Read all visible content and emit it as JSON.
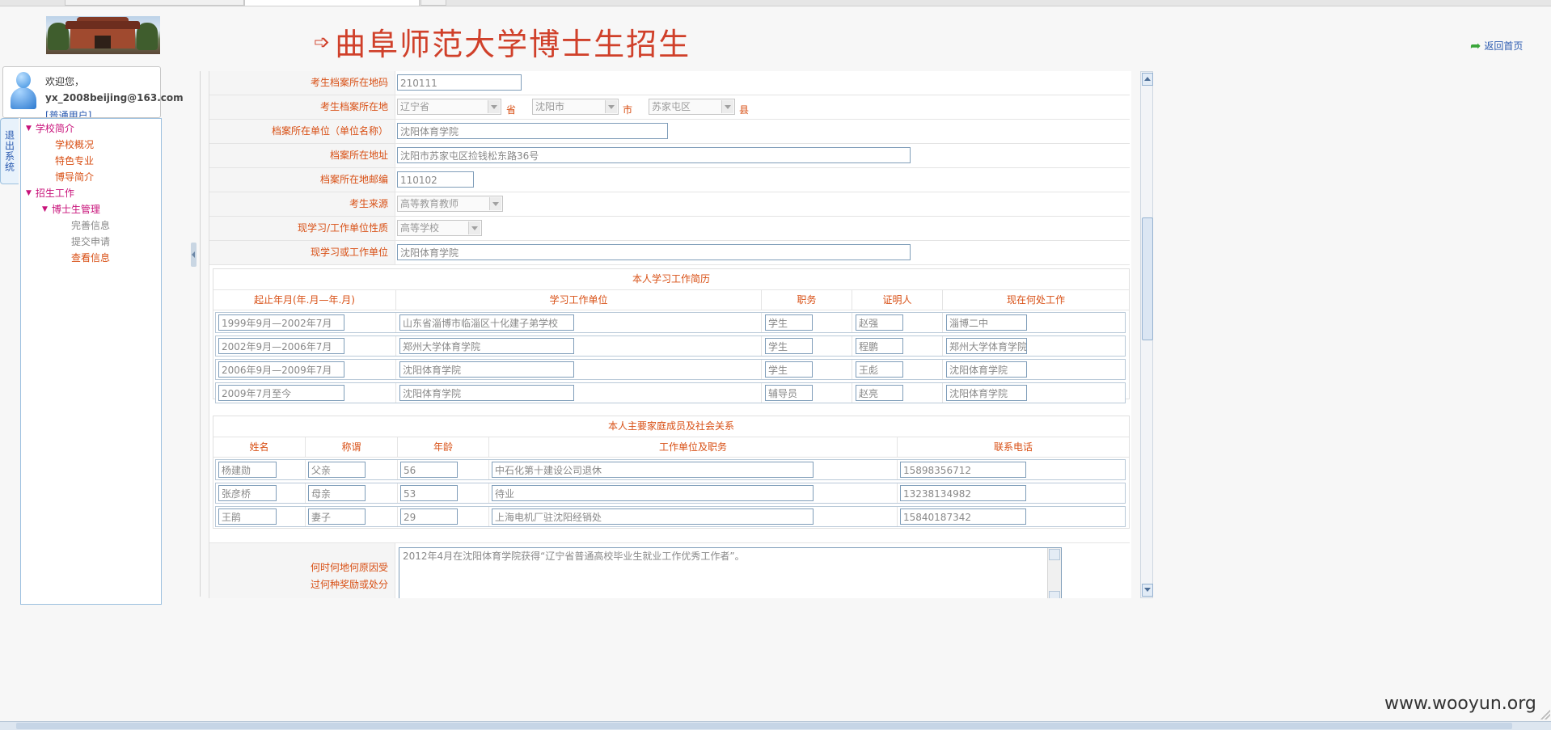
{
  "header": {
    "title": "曲阜师范大学博士生招生",
    "title_arrow": "➩",
    "home_link": "返回首页"
  },
  "user": {
    "welcome": "欢迎您，",
    "email": "yx_2008beijing@163.com",
    "role": "[普通用户]"
  },
  "sidebar": {
    "exit_tab": "退出系统",
    "items": [
      {
        "label": "学校简介",
        "level": 1
      },
      {
        "label": "学校概况",
        "level": 3
      },
      {
        "label": "特色专业",
        "level": 3
      },
      {
        "label": "博导简介",
        "level": 3
      },
      {
        "label": "招生工作",
        "level": 1
      },
      {
        "label": "博士生管理",
        "level": 2
      },
      {
        "label": "完善信息",
        "level": 4
      },
      {
        "label": "提交申请",
        "level": 4
      },
      {
        "label": "查看信息",
        "level": 4,
        "active": true
      }
    ]
  },
  "form": {
    "archive_zip": {
      "label": "考生档案所在地码",
      "value": "210111"
    },
    "archive_location": {
      "label": "考生档案所在地",
      "province": "辽宁省",
      "province_unit": "省",
      "city": "沈阳市",
      "city_unit": "市",
      "county": "苏家屯区",
      "county_unit": "县"
    },
    "archive_unit": {
      "label": "档案所在单位（单位名称）",
      "value": "沈阳体育学院"
    },
    "archive_address": {
      "label": "档案所在地址",
      "value": "沈阳市苏家屯区捡钱松东路36号"
    },
    "archive_postcode": {
      "label": "档案所在地邮编",
      "value": "110102"
    },
    "source": {
      "label": "考生来源",
      "value": "高等教育教师"
    },
    "unit_nature": {
      "label": "现学习/工作单位性质",
      "value": "高等学校"
    },
    "current_unit": {
      "label": "现学习或工作单位",
      "value": "沈阳体育学院"
    }
  },
  "resume": {
    "title": "本人学习工作简历",
    "headers": [
      "起止年月(年.月—年.月)",
      "学习工作单位",
      "职务",
      "证明人",
      "现在何处工作"
    ],
    "rows": [
      [
        "1999年9月—2002年7月",
        "山东省淄博市临淄区十化建子弟学校",
        "学生",
        "赵强",
        "淄博二中"
      ],
      [
        "2002年9月—2006年7月",
        "郑州大学体育学院",
        "学生",
        "程鹏",
        "郑州大学体育学院"
      ],
      [
        "2006年9月—2009年7月",
        "沈阳体育学院",
        "学生",
        "王彪",
        "沈阳体育学院"
      ],
      [
        "2009年7月至今",
        "沈阳体育学院",
        "辅导员",
        "赵亮",
        "沈阳体育学院"
      ]
    ]
  },
  "family": {
    "title": "本人主要家庭成员及社会关系",
    "headers": [
      "姓名",
      "称谓",
      "年龄",
      "工作单位及职务",
      "联系电话"
    ],
    "rows": [
      [
        "杨建勋",
        "父亲",
        "56",
        "中石化第十建设公司退休",
        "15898356712"
      ],
      [
        "张彦桥",
        "母亲",
        "53",
        "待业",
        "13238134982"
      ],
      [
        "王鹃",
        "妻子",
        "29",
        "上海电机厂驻沈阳经销处",
        "15840187342"
      ]
    ]
  },
  "rewards": {
    "label_line1": "何时何地何原因受",
    "label_line2": "过何种奖励或处分",
    "value": "2012年4月在沈阳体育学院获得“辽宁省普通高校毕业生就业工作优秀工作者”。"
  },
  "watermark": "www.wooyun.org"
}
